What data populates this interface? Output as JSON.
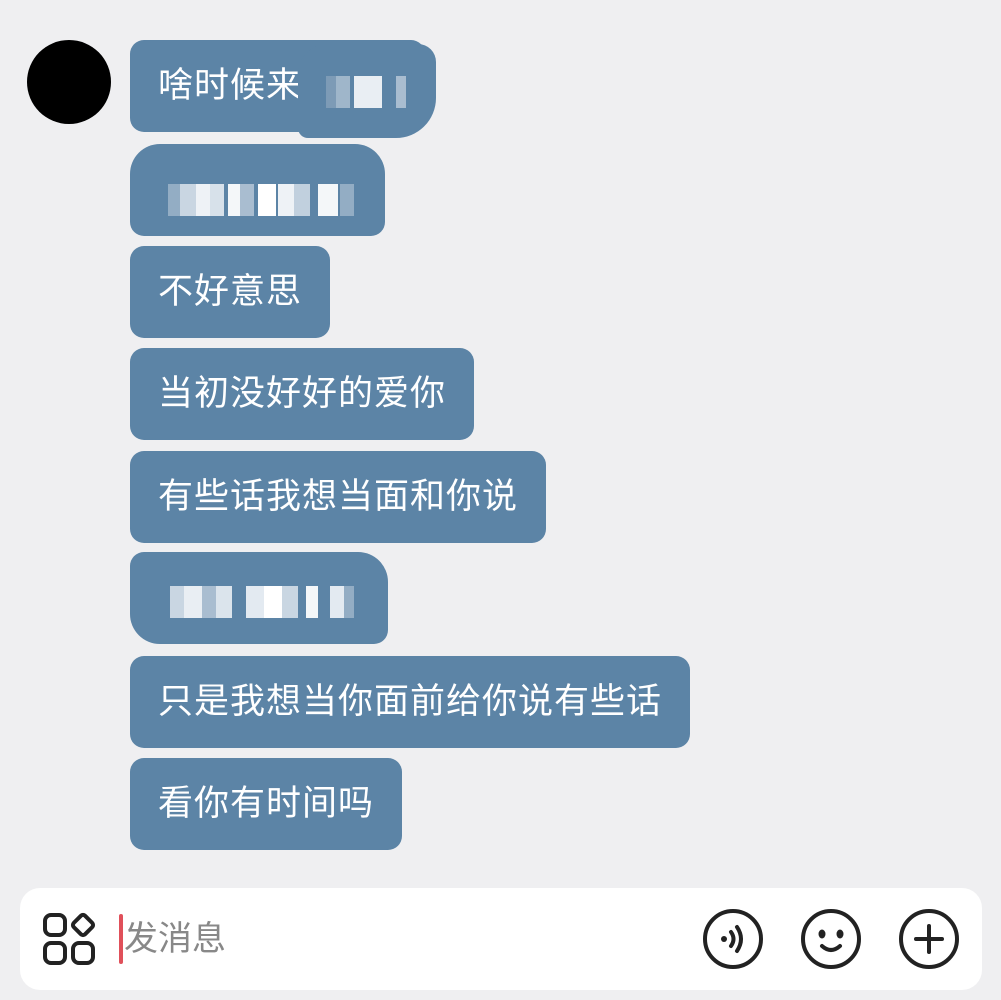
{
  "conversation": {
    "messages": [
      {
        "text": "啥时候来",
        "redacted_suffix": true
      },
      {
        "text": "",
        "redacted": true
      },
      {
        "text": "不好意思"
      },
      {
        "text": "当初没好好的爱你"
      },
      {
        "text": "有些话我想当面和你说"
      },
      {
        "text": "",
        "redacted": true
      },
      {
        "text": "只是我想当你面前给你说有些话"
      },
      {
        "text": "看你有时间吗"
      }
    ]
  },
  "input_bar": {
    "placeholder": "发消息",
    "value": ""
  },
  "icons": {
    "apps": "apps-grid-icon",
    "voice": "voice-icon",
    "emoji": "emoji-icon",
    "add": "plus-icon"
  },
  "colors": {
    "bubble": "#5c84a6",
    "background": "#efeff1",
    "caret": "#e0505a"
  }
}
